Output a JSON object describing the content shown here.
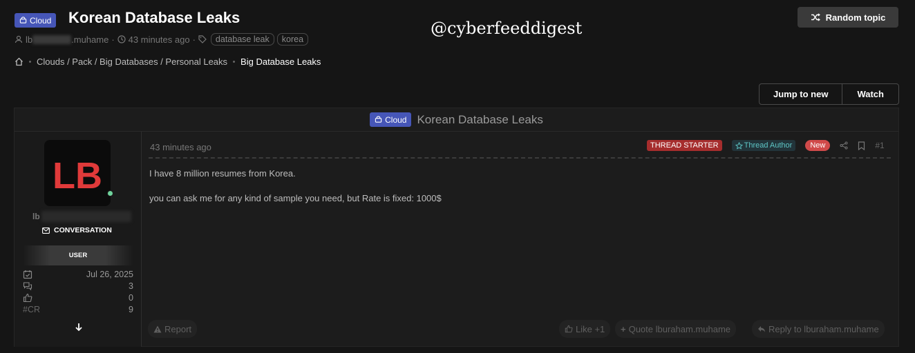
{
  "header": {
    "prefix_badge": "Cloud",
    "title": "Korean Database Leaks",
    "author_prefix": "lb",
    "author_suffix": ".muhame",
    "time_ago": "43 minutes ago",
    "tags": [
      "database leak",
      "korea"
    ],
    "random_topic_label": "Random topic"
  },
  "watermark": "@cyberfeeddigest",
  "breadcrumb": {
    "path": "Clouds / Pack / Big Databases / Personal Leaks",
    "current": "Big Database Leaks"
  },
  "actions": {
    "jump_to_new": "Jump to new",
    "watch": "Watch"
  },
  "thread": {
    "prefix_badge": "Cloud",
    "title": "Korean Database Leaks"
  },
  "user": {
    "avatar_text": "LB",
    "name_visible": "lb",
    "conversation_label": "CONVERSATION",
    "role": "USER",
    "stats": [
      {
        "icon": "calendar-check-icon",
        "value": "Jul 26, 2025"
      },
      {
        "icon": "messages-icon",
        "value": "3"
      },
      {
        "icon": "thumbs-up-icon",
        "value": "0"
      },
      {
        "icon": "cr-label",
        "label": "#CR",
        "value": "9"
      }
    ],
    "status_color": "#6fd39c"
  },
  "post": {
    "time_ago": "43 minutes ago",
    "labels": {
      "starter": "THREAD STARTER",
      "author": "Thread Author",
      "new": "New"
    },
    "number": "#1",
    "lines": [
      "I have 8 million resumes from Korea.",
      "you can ask me for any kind of sample you need, but Rate is fixed: 1000$"
    ],
    "footer": {
      "report": "Report",
      "like": "Like +1",
      "quote": "Quote lburaham.muhame",
      "reply": "Reply to lburaham.muhame"
    }
  },
  "colors": {
    "background": "#151515",
    "panel": "#1c1c1c",
    "prefix_badge": "#4656b8",
    "starter": "#a62d2d",
    "author_badge_text": "#5ec6c6",
    "new_badge": "#d04a4a",
    "logo_red": "#e03a3a"
  }
}
